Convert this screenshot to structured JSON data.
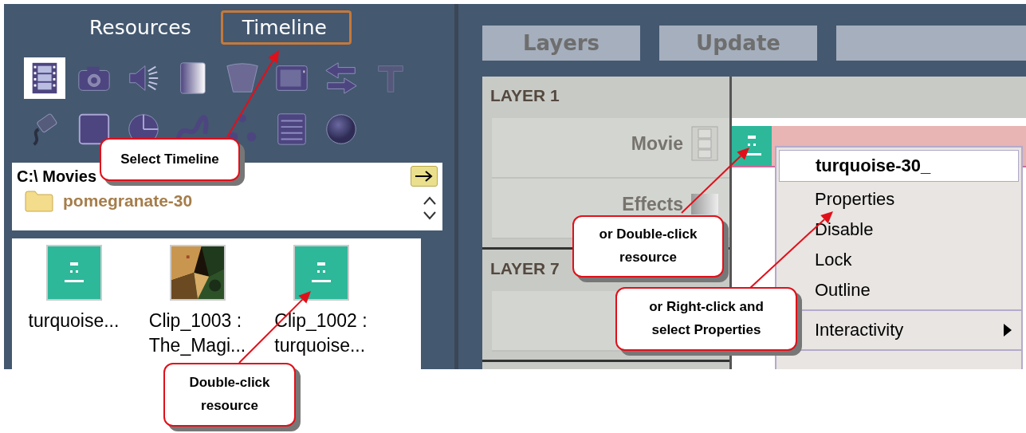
{
  "left_panel": {
    "tabs": [
      {
        "label": "Resources",
        "selected": false
      },
      {
        "label": "Timeline",
        "selected": true
      }
    ],
    "tools": [
      {
        "kind": "film",
        "selected": true
      },
      {
        "kind": "camera",
        "selected": false
      },
      {
        "kind": "speaker",
        "selected": false
      },
      {
        "kind": "gradient",
        "selected": false
      },
      {
        "kind": "trapezoid",
        "selected": false
      },
      {
        "kind": "screen",
        "selected": false
      },
      {
        "kind": "swap",
        "selected": false
      },
      {
        "kind": "text",
        "selected": false
      },
      {
        "kind": "plug",
        "selected": false
      },
      {
        "kind": "square",
        "selected": false
      },
      {
        "kind": "pie",
        "selected": false
      },
      {
        "kind": "curve",
        "selected": false
      },
      {
        "kind": "dots",
        "selected": false
      },
      {
        "kind": "list",
        "selected": false
      },
      {
        "kind": "sphere",
        "selected": false
      }
    ],
    "folder_browser": {
      "path": "C:\\ Movies",
      "folders": [
        "pomegranate-30"
      ]
    },
    "resources": [
      {
        "kind": "clip",
        "lines": [
          "turquoise..."
        ]
      },
      {
        "kind": "picture",
        "lines": [
          "Clip_1003 :",
          "The_Magi..."
        ]
      },
      {
        "kind": "clip",
        "lines": [
          "Clip_1002 :",
          "turquoise..."
        ]
      }
    ]
  },
  "right_panel": {
    "buttons": [
      "Layers",
      "Update"
    ],
    "layers": [
      {
        "title": "LAYER 1",
        "tracks": [
          "Movie",
          "Effects"
        ]
      },
      {
        "title": "LAYER 7"
      }
    ],
    "context_menu": {
      "title": "turquoise-30_",
      "items": [
        {
          "kind": "item",
          "label": "Properties"
        },
        {
          "kind": "item",
          "label": "Disable"
        },
        {
          "kind": "item",
          "label": "Lock"
        },
        {
          "kind": "item",
          "label": "Outline"
        },
        {
          "kind": "separator"
        },
        {
          "kind": "submenu",
          "label": "Interactivity"
        },
        {
          "kind": "separator"
        }
      ]
    }
  },
  "callouts": [
    {
      "lines": [
        "Select Timeline"
      ]
    },
    {
      "lines": [
        "Double-click",
        "resource"
      ]
    },
    {
      "lines": [
        "or Double-click",
        "resource"
      ]
    },
    {
      "lines": [
        "or Right-click  and",
        "select Properties"
      ]
    }
  ]
}
